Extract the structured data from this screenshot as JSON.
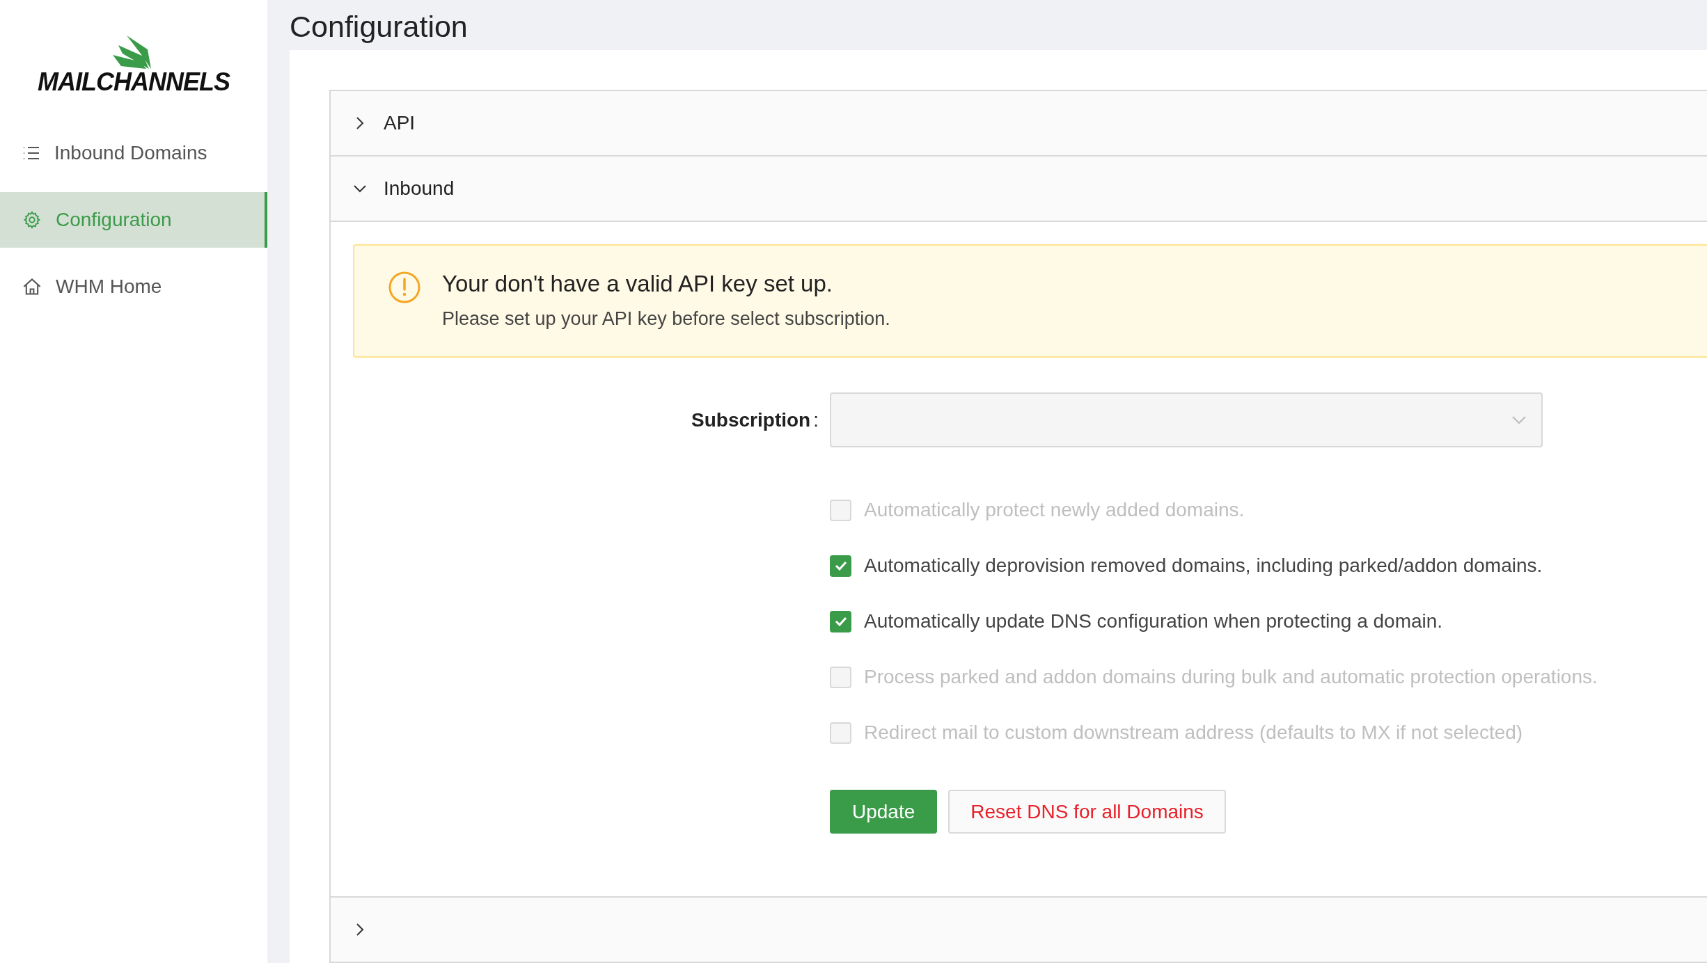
{
  "sidebar": {
    "logo": "MAILCHANNELS",
    "items": [
      {
        "label": "Inbound Domains",
        "kind": "list",
        "selected": false
      },
      {
        "label": "Configuration",
        "kind": "gear",
        "selected": true
      },
      {
        "label": "WHM Home",
        "kind": "home",
        "selected": false
      }
    ]
  },
  "page_title": "Configuration",
  "panels": [
    {
      "title": "API",
      "expanded": false
    },
    {
      "title": "Inbound",
      "expanded": true,
      "alert": {
        "title": "Your don't have a valid API key set up.",
        "message": "Please set up your API key before select subscription."
      },
      "subscription": {
        "label": "Subscription",
        "separator": ":"
      },
      "options": [
        {
          "label": "Automatically protect newly added domains.",
          "checked": false,
          "disabled": true
        },
        {
          "label": "Automatically deprovision removed domains, including parked/addon domains.",
          "checked": true,
          "disabled": false
        },
        {
          "label": "Automatically update DNS configuration when protecting a domain.",
          "checked": true,
          "disabled": false
        },
        {
          "label": "Process parked and addon domains during bulk and automatic protection operations.",
          "checked": false,
          "disabled": true
        },
        {
          "label": "Redirect mail to custom downstream address (defaults to MX if not selected)",
          "checked": false,
          "disabled": true
        }
      ],
      "buttons": [
        {
          "label": "Update",
          "kind": "primary"
        },
        {
          "label": "Reset DNS for all Domains",
          "kind": "danger"
        }
      ]
    },
    {
      "expanded": false
    }
  ]
}
